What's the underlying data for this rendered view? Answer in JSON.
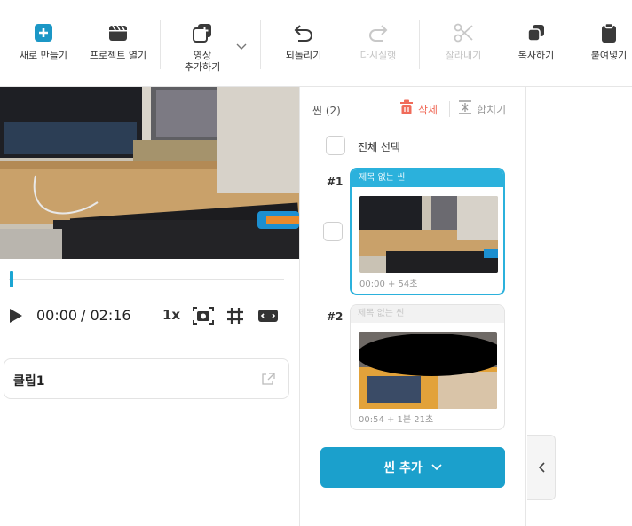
{
  "toolbar": {
    "new": "새로 만들기",
    "open_project": "프로젝트 열기",
    "add_video_line1": "영상",
    "add_video_line2": "추가하기",
    "undo": "되돌리기",
    "redo": "다시실행",
    "cut": "잘라내기",
    "copy": "복사하기",
    "paste": "붙여넣기"
  },
  "player": {
    "current_time": "00:00",
    "total_time": "/ 02:16",
    "speed": "1x",
    "progress": 0
  },
  "clip": {
    "name": "클립1"
  },
  "scenes": {
    "title": "씬 (2)",
    "delete_label": "삭제",
    "merge_label": "합치기",
    "select_all": "전체 선택",
    "items": [
      {
        "number": "#1",
        "title": "제목 없는 씬",
        "duration": "00:00 + 54초",
        "selected": true
      },
      {
        "number": "#2",
        "title": "제목 없는 씬",
        "duration": "00:54 + 1분 21초",
        "selected": false
      }
    ],
    "add_label": "씬 추가"
  },
  "colors": {
    "accent": "#1ba0cc",
    "delete": "#f06b5a"
  }
}
